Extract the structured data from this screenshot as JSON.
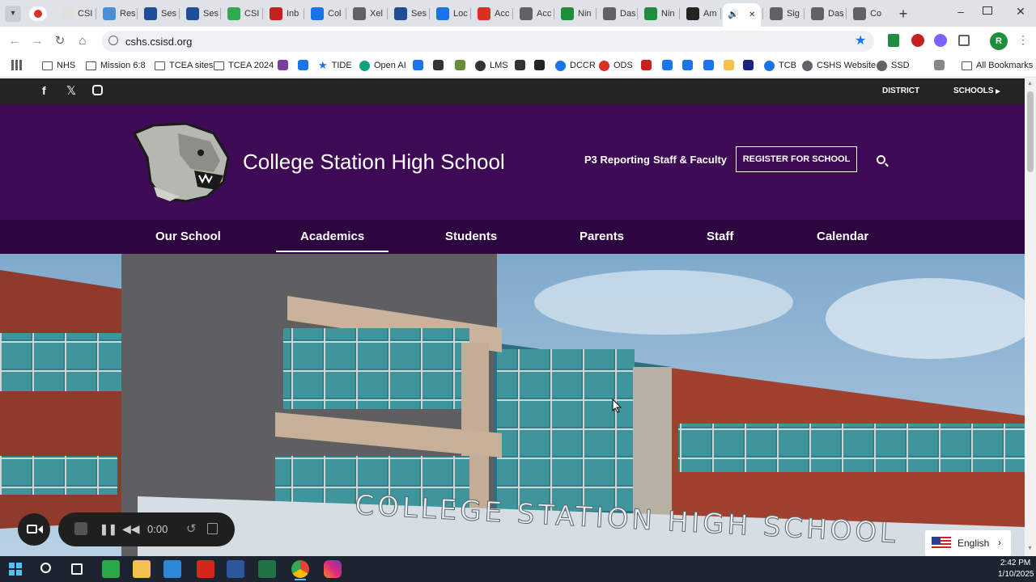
{
  "browser": {
    "tabs": [
      {
        "label": "CSI",
        "color": "#e0e0e0"
      },
      {
        "label": "Res",
        "color": "#4a90d9"
      },
      {
        "label": "Ses",
        "color": "#1f4e99"
      },
      {
        "label": "Ses",
        "color": "#1f4e99"
      },
      {
        "label": "CSI",
        "color": "#34a853"
      },
      {
        "label": "Inb",
        "color": "#c5221f"
      },
      {
        "label": "Col",
        "color": "#1a73e8"
      },
      {
        "label": "Xel",
        "color": "#5f6368"
      },
      {
        "label": "Ses",
        "color": "#1f4e99"
      },
      {
        "label": "Loc",
        "color": "#1a73e8"
      },
      {
        "label": "Acc",
        "color": "#d93025"
      },
      {
        "label": "Acc",
        "color": "#5f6368"
      },
      {
        "label": "Nin",
        "color": "#1e8e3e"
      },
      {
        "label": "Das",
        "color": "#5f6368"
      },
      {
        "label": "Nin",
        "color": "#1e8e3e"
      },
      {
        "label": "Am",
        "color": "#222222"
      },
      {
        "label": "",
        "color": "#ffffff"
      },
      {
        "label": "Sig",
        "color": "#5f6368"
      },
      {
        "label": "Das",
        "color": "#5f6368"
      },
      {
        "label": "Co",
        "color": "#5f6368"
      }
    ],
    "url": "cshs.csisd.org",
    "bookmarks": [
      {
        "label": "NHS",
        "type": "folder"
      },
      {
        "label": "Mission 6:8",
        "type": "folder"
      },
      {
        "label": "TCEA sites",
        "type": "folder"
      },
      {
        "label": "TCEA 2024",
        "type": "folder"
      },
      {
        "label": "TIDE",
        "type": "star"
      },
      {
        "label": "Open AI",
        "type": "icon"
      },
      {
        "label": "LMS",
        "type": "icon"
      },
      {
        "label": "DCCR",
        "type": "icon"
      },
      {
        "label": "ODS",
        "type": "icon"
      },
      {
        "label": "TCB",
        "type": "icon"
      },
      {
        "label": "CSHS Website",
        "type": "icon"
      },
      {
        "label": "SSD",
        "type": "icon"
      },
      {
        "label": "All Bookmarks",
        "type": "folder"
      }
    ]
  },
  "site": {
    "topbar": {
      "district": "DISTRICT",
      "schools": "SCHOOLS"
    },
    "header": {
      "title": "College Station High School",
      "links": [
        "P3 Reporting",
        "Staff & Faculty"
      ],
      "register": "REGISTER FOR SCHOOL"
    },
    "nav": [
      "Our School",
      "Academics",
      "Students",
      "Parents",
      "Staff",
      "Calendar"
    ],
    "active_nav": "Academics",
    "hero_sign": "COLLEGE STATION HIGH SCHOOL",
    "language": "English"
  },
  "recorder": {
    "time": "0:00"
  },
  "taskbar": {
    "time": "2:42 PM",
    "date": "1/10/2025"
  },
  "colors": {
    "header_purple": "#3f0a55",
    "nav_purple": "#2d0640",
    "topbar": "#242424"
  }
}
